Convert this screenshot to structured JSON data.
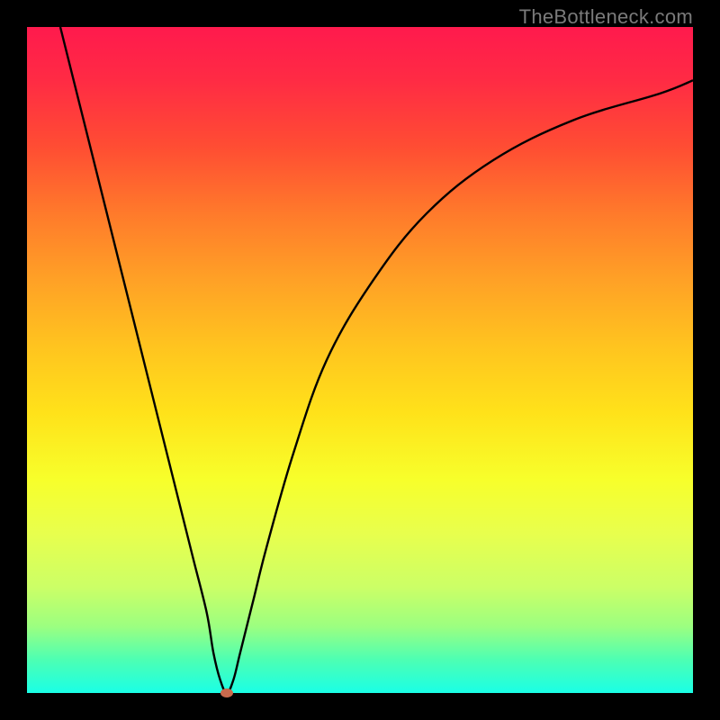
{
  "watermark": "TheBottleneck.com",
  "chart_data": {
    "type": "line",
    "title": "",
    "xlabel": "",
    "ylabel": "",
    "xlim": [
      0,
      100
    ],
    "ylim": [
      0,
      100
    ],
    "series": [
      {
        "name": "bottleneck-curve",
        "x": [
          5,
          8,
          12,
          16,
          20,
          23,
          25,
          27,
          28,
          29,
          30,
          31,
          32,
          34,
          36,
          40,
          45,
          52,
          60,
          70,
          82,
          95,
          100
        ],
        "y": [
          100,
          88,
          72,
          56,
          40,
          28,
          20,
          12,
          6,
          2,
          0,
          2,
          6,
          14,
          22,
          36,
          50,
          62,
          72,
          80,
          86,
          90,
          92
        ]
      }
    ],
    "marker": {
      "x": 30,
      "y": 0,
      "color": "#c96a4d"
    },
    "gradient_stops": [
      {
        "pos": 0,
        "color": "#ff1a4d"
      },
      {
        "pos": 50,
        "color": "#ffd21a"
      },
      {
        "pos": 100,
        "color": "#1affe6"
      }
    ]
  }
}
